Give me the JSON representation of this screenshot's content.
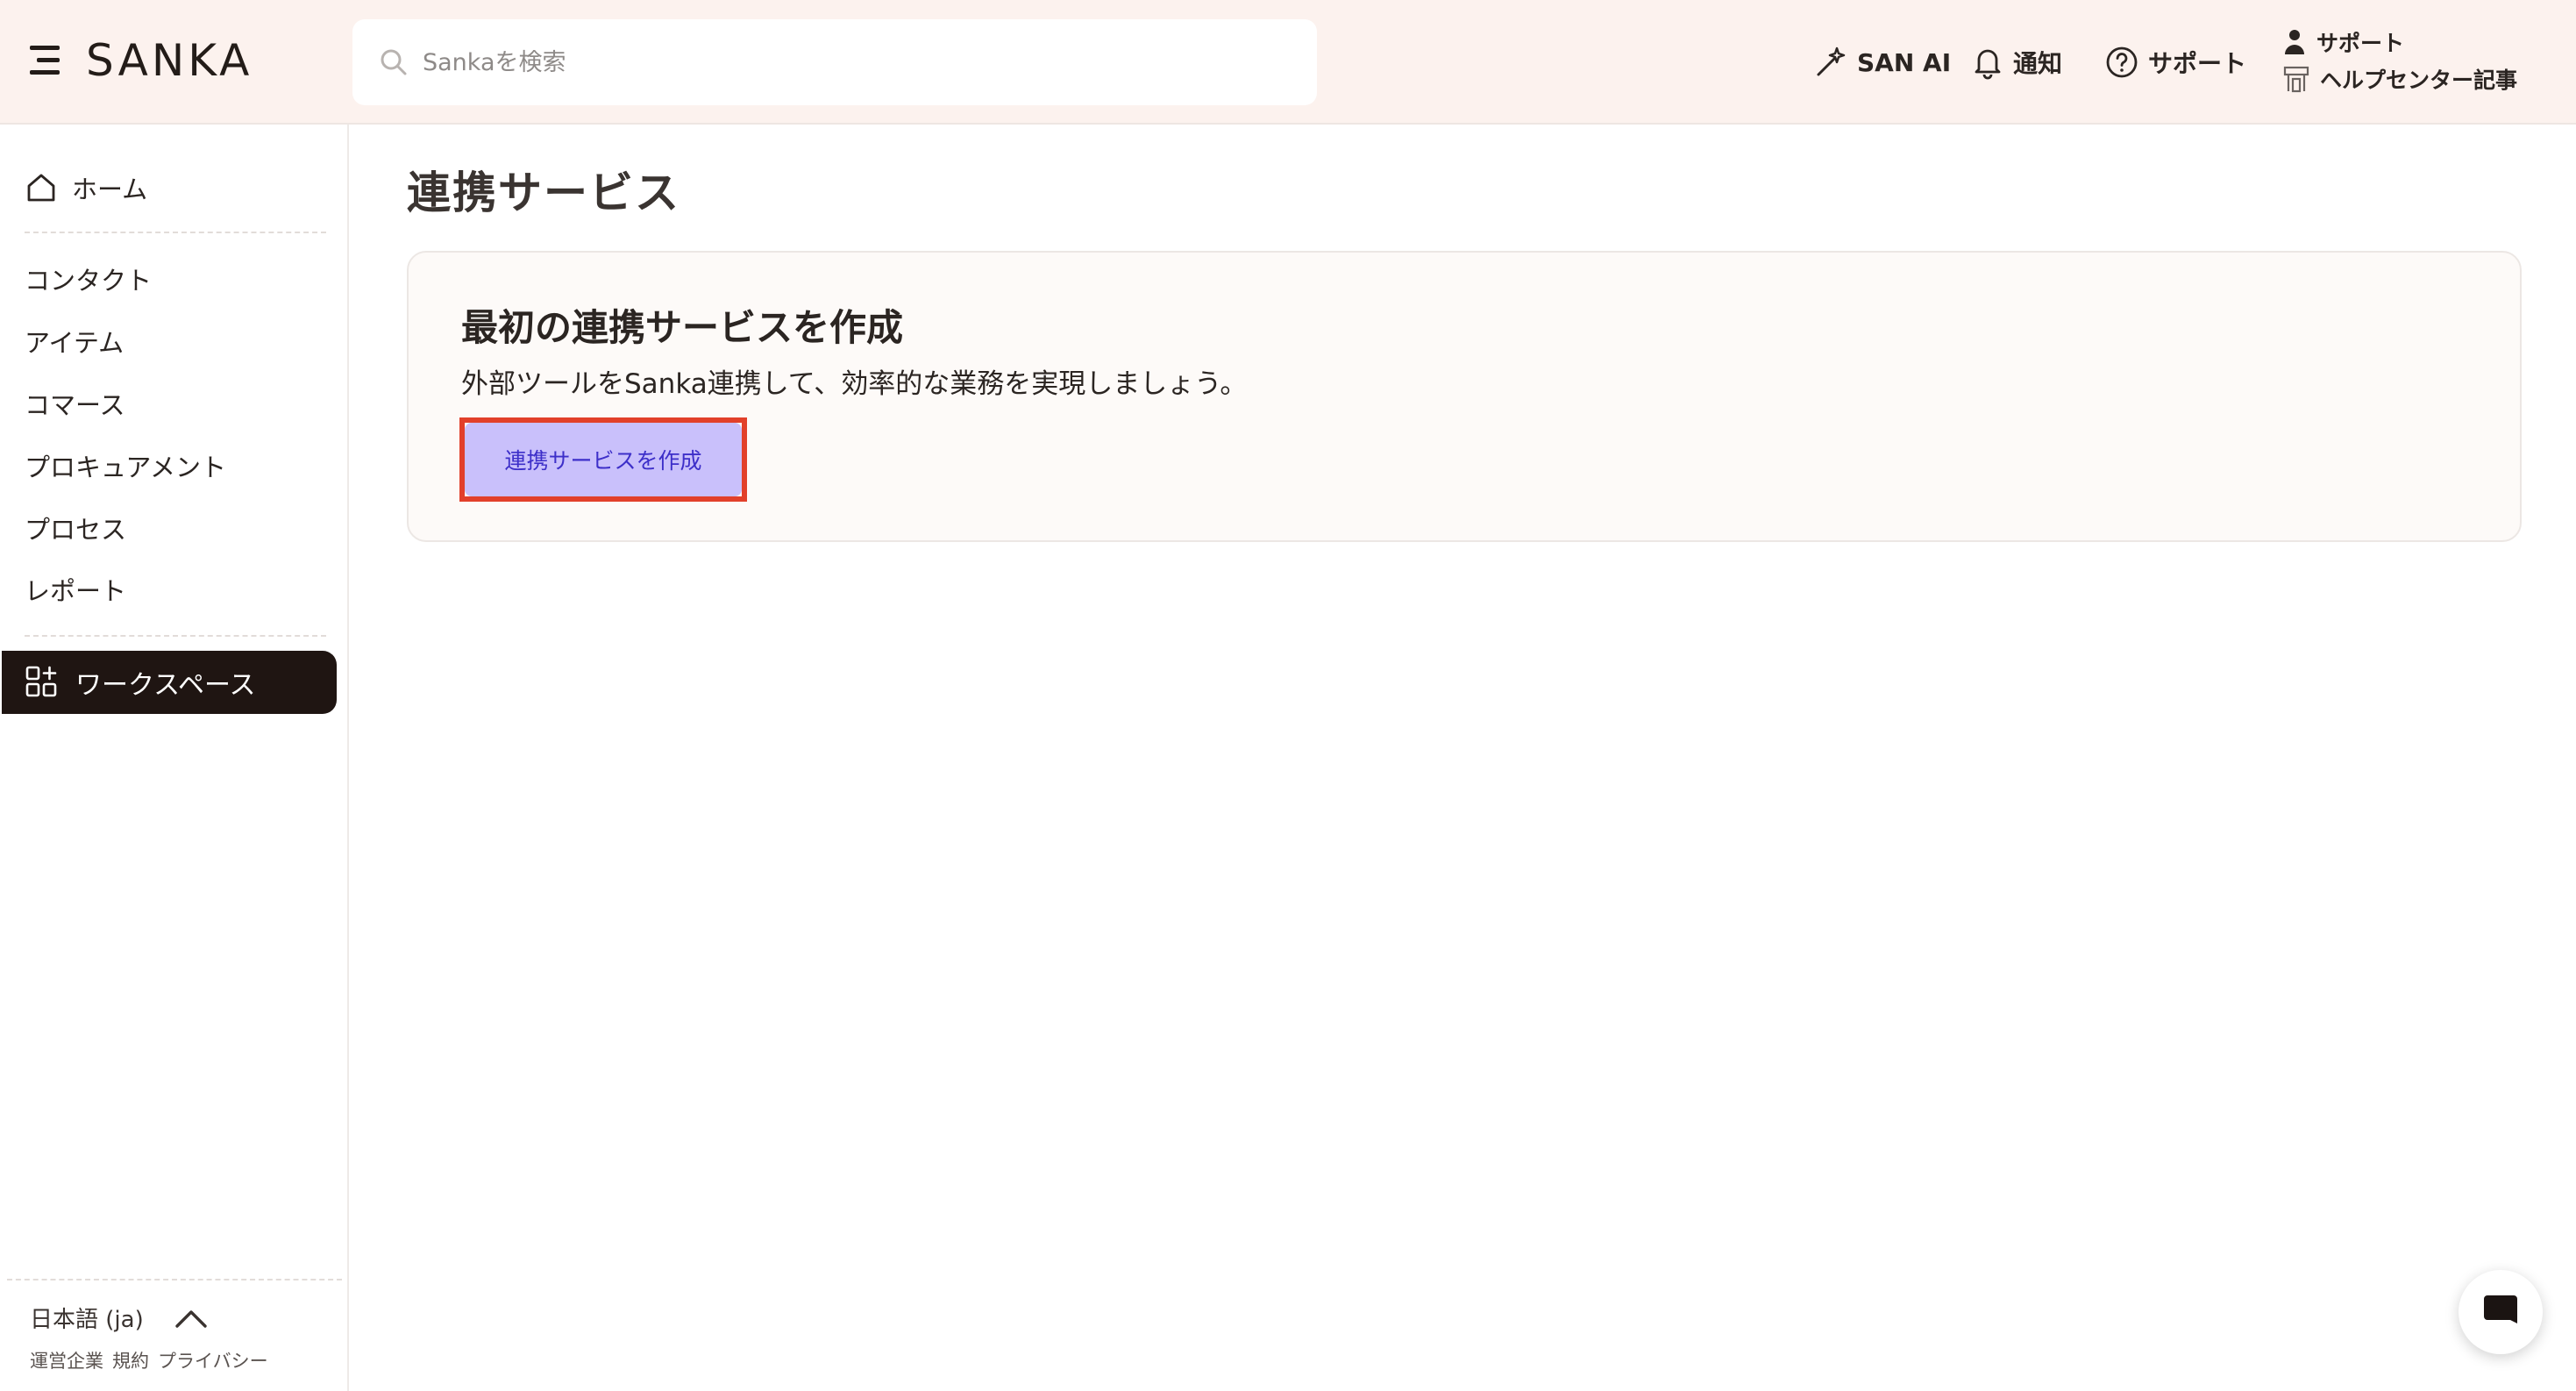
{
  "header": {
    "brand": "SANKA",
    "search_placeholder": "Sankaを検索",
    "san_ai_label": "SAN AI",
    "notifications_label": "通知",
    "support_label": "サポート",
    "support_block": {
      "line1": "サポート",
      "line2": "ヘルプセンター記事"
    }
  },
  "sidebar": {
    "home_label": "ホーム",
    "items": [
      {
        "label": "コンタクト"
      },
      {
        "label": "アイテム"
      },
      {
        "label": "コマース"
      },
      {
        "label": "プロキュアメント"
      },
      {
        "label": "プロセス"
      },
      {
        "label": "レポート"
      }
    ],
    "active_label": "ワークスペース",
    "language": "日本語 (ja)",
    "footer_links": [
      "運営企業",
      "規約",
      "プライバシー"
    ]
  },
  "main": {
    "page_title": "連携サービス",
    "card": {
      "title": "最初の連携サービスを作成",
      "description": "外部ツールをSanka連携して、効率的な業務を実現しましょう。",
      "button_label": "連携サービスを作成"
    }
  },
  "colors": {
    "header_bg": "#fcf2ee",
    "active_nav_bg": "#1f1512",
    "button_bg": "#c9c0fb",
    "button_text": "#3d2fc9",
    "highlight_border": "#e2402a"
  },
  "icons": {
    "menu": "hamburger-icon",
    "search": "search-icon",
    "san_ai": "magic-wand-icon",
    "notifications": "bell-icon",
    "support": "question-circle-icon",
    "support_person": "person-icon",
    "help_center": "storefront-icon",
    "home": "home-icon",
    "workspace": "grid-plus-icon",
    "language_toggle": "chevron-up-icon",
    "chat": "chat-bubble-icon"
  }
}
